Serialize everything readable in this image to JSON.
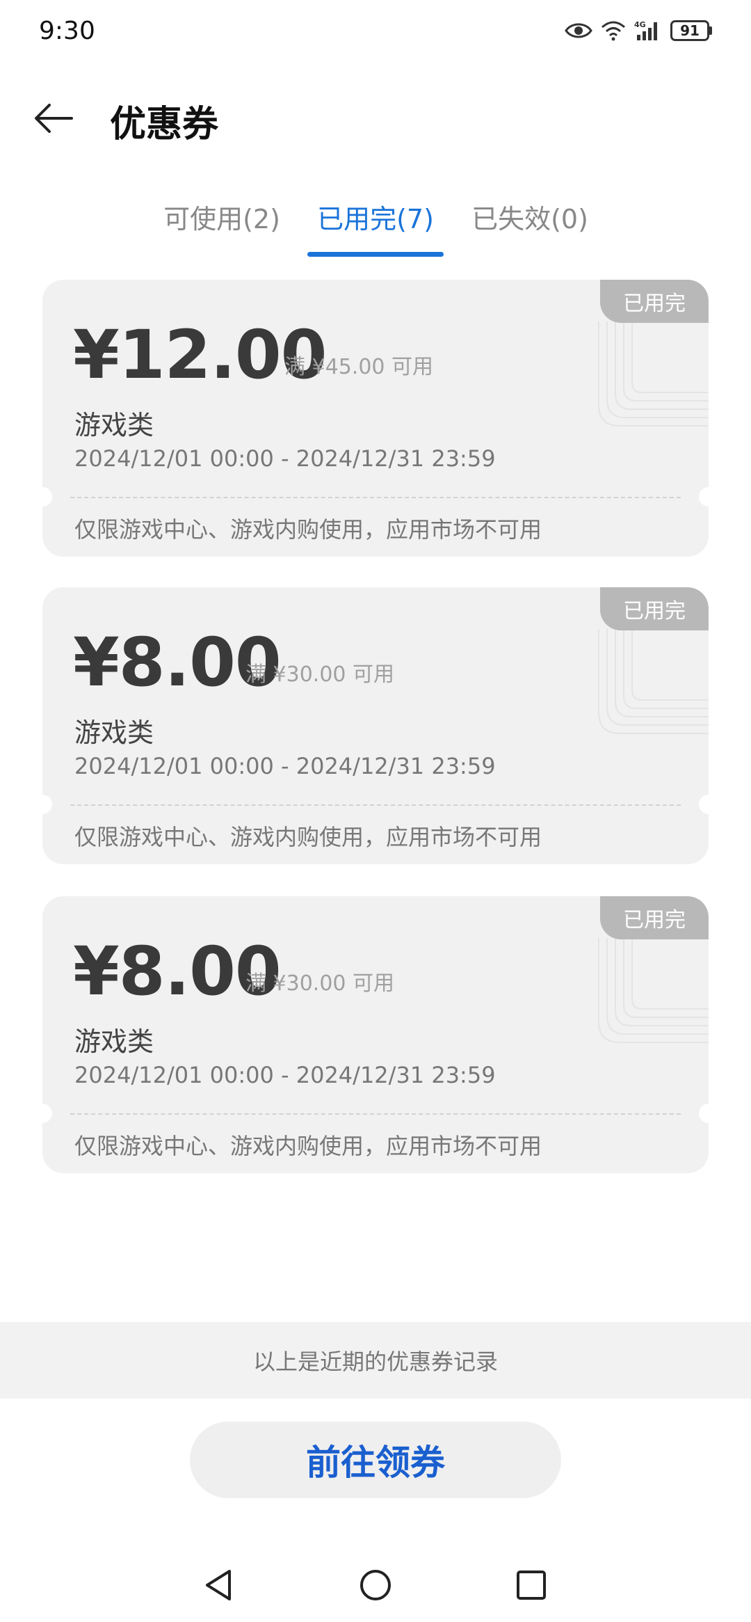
{
  "status_bar": {
    "time": "9:30",
    "network": "4G",
    "battery": "91",
    "icons": [
      "eye-icon",
      "wifi-icon",
      "signal-icon",
      "battery-icon"
    ]
  },
  "header": {
    "title": "优惠券",
    "back_icon": "arrow-left-icon"
  },
  "tabs": [
    {
      "label": "可使用(2)",
      "active": false
    },
    {
      "label": "已用完(7)",
      "active": true
    },
    {
      "label": "已失效(0)",
      "active": false
    }
  ],
  "coupons": [
    {
      "amount": "¥12.00",
      "threshold": "满 ¥45.00 可用",
      "category": "游戏类",
      "period": "2024/12/01 00:00 - 2024/12/31 23:59",
      "note": "仅限游戏中心、游戏内购使用，应用市场不可用",
      "badge": "已用完"
    },
    {
      "amount": "¥8.00",
      "threshold": "满 ¥30.00 可用",
      "category": "游戏类",
      "period": "2024/12/01 00:00 - 2024/12/31 23:59",
      "note": "仅限游戏中心、游戏内购使用，应用市场不可用",
      "badge": "已用完"
    },
    {
      "amount": "¥8.00",
      "threshold": "满 ¥30.00 可用",
      "category": "游戏类",
      "period": "2024/12/01 00:00 - 2024/12/31 23:59",
      "note": "仅限游戏中心、游戏内购使用，应用市场不可用",
      "badge": "已用完"
    }
  ],
  "footer": {
    "note": "以上是近期的优惠券记录",
    "button_label": "前往领券"
  },
  "colors": {
    "accent": "#1a73d9",
    "button_text": "#1a5fcf",
    "card_bg": "#f1f1f1",
    "badge_bg": "#b8b8b8"
  },
  "nav_bar": {
    "icons": [
      "back-triangle-icon",
      "home-circle-icon",
      "recents-square-icon"
    ]
  }
}
